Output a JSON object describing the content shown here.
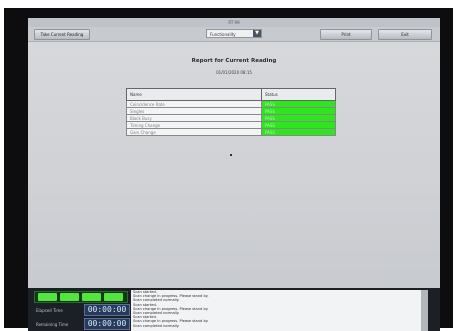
{
  "window": {
    "title": "RT 99"
  },
  "toolbar": {
    "take_reading_label": "Take Current Reading",
    "dropdown_value": "Functionality",
    "print_label": "Print",
    "exit_label": "Exit"
  },
  "report": {
    "title": "Report for Current Reading",
    "timestamp": "01/01/2020 08:15",
    "columns": [
      "Name",
      "Status"
    ],
    "rows": [
      {
        "name": "Coincidence Rate",
        "status": "PASS"
      },
      {
        "name": "Singles",
        "status": "PASS"
      },
      {
        "name": "Block Busy",
        "status": "PASS"
      },
      {
        "name": "Timing Change",
        "status": "PASS"
      },
      {
        "name": "Gain Change",
        "status": "PASS"
      }
    ]
  },
  "status_panel": {
    "elapsed_label": "Elapsed Time",
    "elapsed_value": "00:00:00",
    "remaining_label": "Remaining Time",
    "remaining_value": "00:00:00",
    "log_lines": [
      "Scan started.",
      "Scan change in progress. Please stand by.",
      "Scan completed normally.",
      "Scan started.",
      "Scan change in progress. Please stand by.",
      "Scan completed normally.",
      "Scan started.",
      "Scan change in progress. Please stand by.",
      "Scan completed normally."
    ]
  },
  "colors": {
    "pass_green": "#2ee61e",
    "panel_dark": "#1c2026",
    "lamp_green": "#53e53d"
  }
}
